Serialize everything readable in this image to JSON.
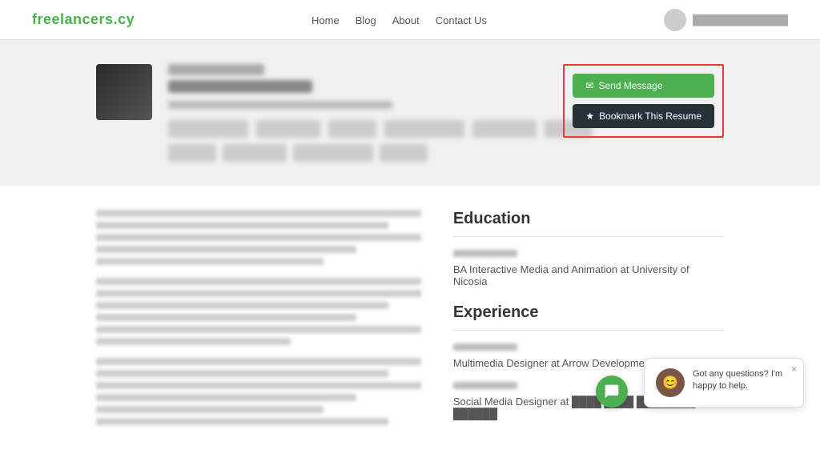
{
  "navbar": {
    "brand": "freelancers.cy",
    "nav_items": [
      {
        "label": "Home",
        "href": "#"
      },
      {
        "label": "Blog",
        "href": "#"
      },
      {
        "label": "About",
        "href": "#"
      },
      {
        "label": "Contact Us",
        "href": "#"
      }
    ],
    "user_text": "██████████████"
  },
  "profile": {
    "send_message_label": "Send Message",
    "bookmark_label": "Bookmark This Resume",
    "name_blurred": true,
    "title_blurred": true
  },
  "education": {
    "section_title": "Education",
    "items": [
      {
        "date": "████ ████",
        "title": "BA Interactive Media and Animation at University of Nicosia",
        "sub": ""
      }
    ]
  },
  "experience": {
    "section_title": "Experience",
    "items": [
      {
        "date": "████ ████ – ████ ████",
        "title": "Multimedia Designer at Arrow Development Organization",
        "sub": ""
      },
      {
        "date": "████ ████",
        "title": "Social Media Designer at ████ ████ ████████ ██████",
        "sub": ""
      }
    ]
  },
  "chat": {
    "message": "Got any questions? I'm happy to help.",
    "close_label": "×"
  },
  "icons": {
    "send": "✉",
    "bookmark": "★",
    "user": "👤",
    "chat_face": "😊"
  }
}
